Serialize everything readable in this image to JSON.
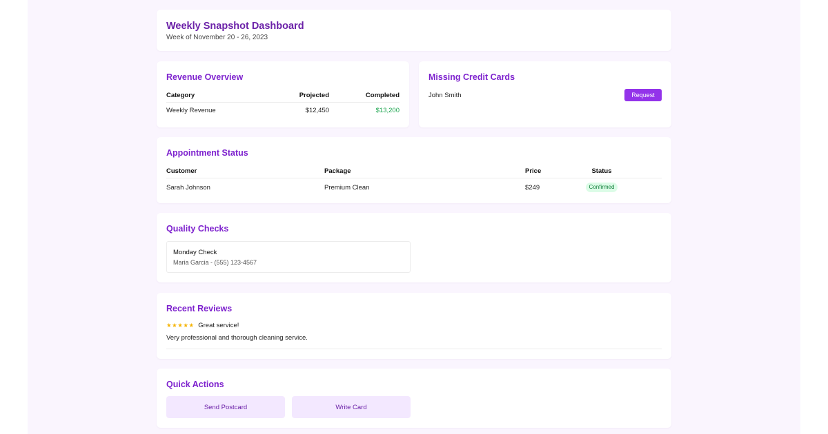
{
  "header": {
    "title": "Weekly Snapshot Dashboard",
    "subtitle": "Week of November 20 - 26, 2023"
  },
  "revenue": {
    "title": "Revenue Overview",
    "columns": [
      "Category",
      "Projected",
      "Completed"
    ],
    "rows": [
      {
        "category": "Weekly Revenue",
        "projected": "$12,450",
        "completed": "$13,200"
      }
    ]
  },
  "missing_cards": {
    "title": "Missing Credit Cards",
    "items": [
      {
        "name": "John Smith",
        "action_label": "Request"
      }
    ]
  },
  "appointments": {
    "title": "Appointment Status",
    "columns": [
      "Customer",
      "Package",
      "Price",
      "Status"
    ],
    "rows": [
      {
        "customer": "Sarah Johnson",
        "package": "Premium Clean",
        "price": "$249",
        "status": "Confirmed"
      }
    ]
  },
  "quality": {
    "title": "Quality Checks",
    "items": [
      {
        "title": "Monday Check",
        "detail": "Maria Garcia - (555) 123-4567"
      }
    ]
  },
  "reviews": {
    "title": "Recent Reviews",
    "items": [
      {
        "stars": "★★★★★",
        "rating": 5,
        "headline": "Great service!",
        "body": "Very professional and thorough cleaning service."
      }
    ]
  },
  "quick_actions": {
    "title": "Quick Actions",
    "buttons": [
      "Send Postcard",
      "Write Card"
    ]
  },
  "colors": {
    "accent": "#9333ea",
    "heading": "#7e22ce",
    "success": "#16a34a",
    "background": "#faf5fe",
    "star": "#f5b301"
  }
}
